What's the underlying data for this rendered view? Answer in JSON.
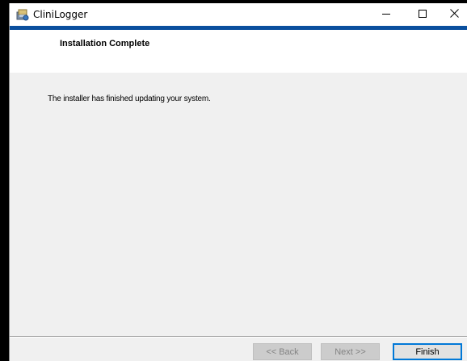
{
  "window": {
    "title": "CliniLogger",
    "minimize_glyph": "—",
    "close_glyph": "✕"
  },
  "header": {
    "title": "Installation Complete"
  },
  "body": {
    "message": "The installer has finished updating your system."
  },
  "buttons": {
    "back_label": "<< Back",
    "next_label": "Next >>",
    "finish_label": "Finish"
  },
  "colors": {
    "accent_strip": "#0a4f9e",
    "focus_border": "#0078d7"
  },
  "icons": {
    "app": "installer-app-icon",
    "minimize": "minimize-icon",
    "maximize": "maximize-icon",
    "close": "close-icon"
  }
}
